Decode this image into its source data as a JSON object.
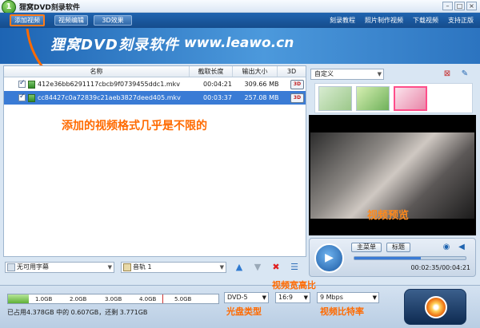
{
  "window": {
    "title": "狸窝DVD刻录软件",
    "logo_text": "1"
  },
  "nav": {
    "tabs": [
      {
        "label": "添加视频"
      },
      {
        "label": "视频编辑"
      },
      {
        "label": "3D效果"
      }
    ],
    "links": [
      {
        "label": "刻录教程"
      },
      {
        "label": "照片制作视频"
      },
      {
        "label": "下载视频"
      },
      {
        "label": "支持正版"
      }
    ]
  },
  "banner": {
    "title": "狸窝DVD刻录软件",
    "url": "www.leawo.cn"
  },
  "file_list": {
    "columns": [
      "名称",
      "截取长度",
      "输出大小",
      "3D"
    ],
    "rows": [
      {
        "name": "412e36bb6291117cbcb9f0739455ddc1.mkv",
        "length": "00:04:21",
        "size": "309.66 MB",
        "selected": false
      },
      {
        "name": "cc84427c0a72839c21aeb3827deed405.mkv",
        "length": "00:03:37",
        "size": "257.08 MB",
        "selected": true
      }
    ],
    "btn_3d_label": "3D"
  },
  "annotations": {
    "list_note": "添加的视频格式几乎是不限的",
    "preview_note": "视频预览",
    "aspect_note": "视频宽高比",
    "disc_note": "光盘类型",
    "bitrate_note": "视频比特率"
  },
  "controls": {
    "subtitle_select": "无可用字幕",
    "audio_select": "音轨 1"
  },
  "right_panel": {
    "preset_select": "自定义",
    "player_buttons": [
      "主菜单",
      "标题"
    ],
    "time": "00:02:35/00:04:21",
    "progress": 0.595
  },
  "bottom": {
    "capacity_ticks": [
      "1.0GB",
      "2.0GB",
      "3.0GB",
      "4.0GB",
      "5.0GB"
    ],
    "capacity_used_gb": 0.607,
    "capacity_total_gb": 4.378,
    "capacity_info": "已占用4.378GB 中的 0.607GB，还剩 3.771GB",
    "disc_type": "DVD-5",
    "aspect_ratio": "16:9",
    "bitrate": "9 Mbps"
  },
  "colors": {
    "accent": "#3a7bd5",
    "annotation": "#ff6a00",
    "nav": "#1f64b0"
  }
}
